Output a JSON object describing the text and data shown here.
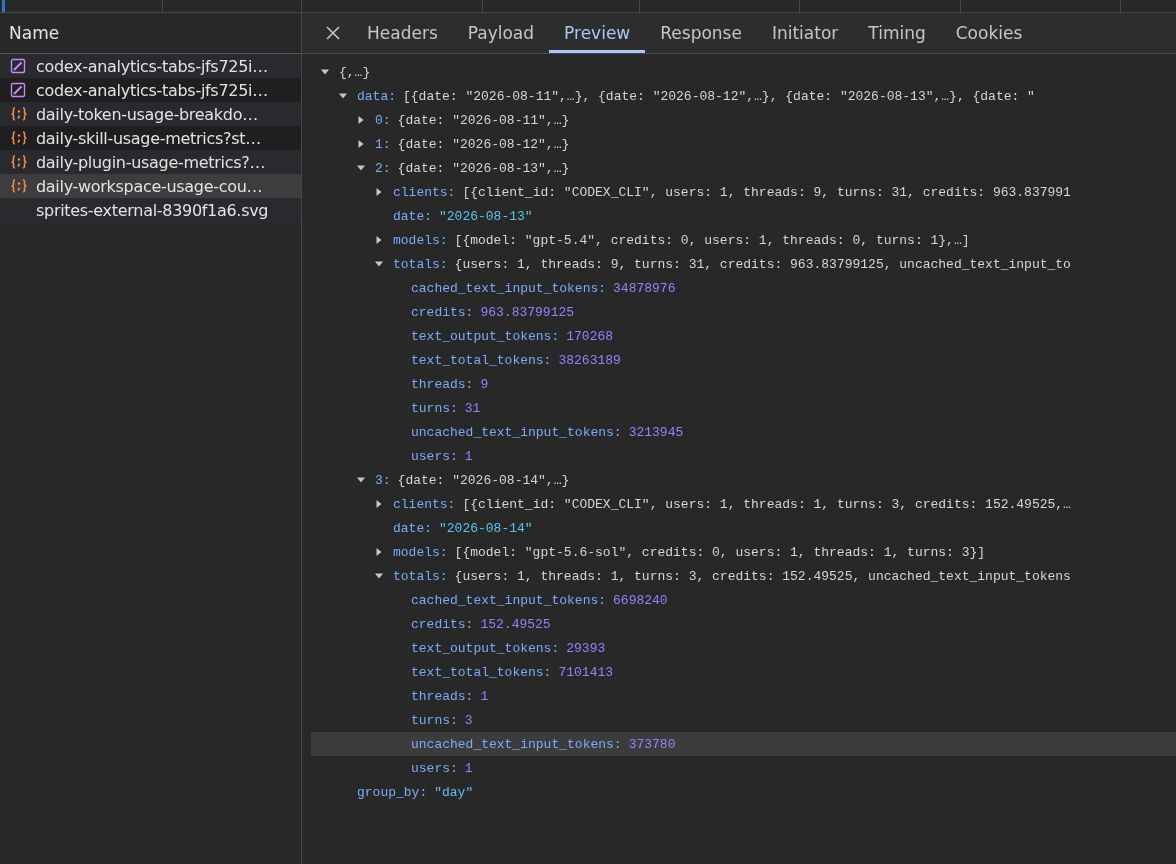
{
  "requests": {
    "header": "Name",
    "items": [
      {
        "name": "codex-analytics-tabs-jfs725i…",
        "kind": "image",
        "selected": false
      },
      {
        "name": "codex-analytics-tabs-jfs725i…",
        "kind": "image",
        "selected": false
      },
      {
        "name": "daily-token-usage-breakdo…",
        "kind": "json",
        "selected": false
      },
      {
        "name": "daily-skill-usage-metrics?st…",
        "kind": "json",
        "selected": false
      },
      {
        "name": "daily-plugin-usage-metrics?…",
        "kind": "json",
        "selected": false
      },
      {
        "name": "daily-workspace-usage-cou…",
        "kind": "json",
        "selected": true
      },
      {
        "name": "sprites-external-8390f1a6.svg",
        "kind": "none",
        "selected": false
      }
    ]
  },
  "detail_tabs": [
    {
      "label": "Headers",
      "selected": false
    },
    {
      "label": "Payload",
      "selected": false
    },
    {
      "label": "Preview",
      "selected": true
    },
    {
      "label": "Response",
      "selected": false
    },
    {
      "label": "Initiator",
      "selected": false
    },
    {
      "label": "Timing",
      "selected": false
    },
    {
      "label": "Cookies",
      "selected": false
    }
  ],
  "preview": {
    "root": {
      "kind": "object",
      "summary": "{,…}",
      "expanded": true,
      "selected": false,
      "children": [
        {
          "key": "data:",
          "kind": "object",
          "summary": "[{date: \"2026-08-11\",…}, {date: \"2026-08-12\",…}, {date: \"2026-08-13\",…}, {date: \"",
          "expanded": true,
          "selected": false,
          "children": [
            {
              "key": "0:",
              "kind": "object",
              "summary": "{date: \"2026-08-11\",…}",
              "expanded": false,
              "selected": false
            },
            {
              "key": "1:",
              "kind": "object",
              "summary": "{date: \"2026-08-12\",…}",
              "expanded": false,
              "selected": false
            },
            {
              "key": "2:",
              "kind": "object",
              "summary": "{date: \"2026-08-13\",…}",
              "expanded": true,
              "selected": false,
              "children": [
                {
                  "key": "clients:",
                  "kind": "object",
                  "summary": "[{client_id: \"CODEX_CLI\", users: 1, threads: 9, turns: 31, credits: 963.837991",
                  "expanded": false,
                  "selected": false
                },
                {
                  "key": "date:",
                  "kind": "string",
                  "value": "\"2026-08-13\"",
                  "selected": false
                },
                {
                  "key": "models:",
                  "kind": "object",
                  "summary": "[{model: \"gpt-5.4\", credits: 0, users: 1, threads: 0, turns: 1},…]",
                  "expanded": false,
                  "selected": false
                },
                {
                  "key": "totals:",
                  "kind": "object",
                  "summary": "{users: 1, threads: 9, turns: 31, credits: 963.83799125, uncached_text_input_to",
                  "expanded": true,
                  "selected": false,
                  "children": [
                    {
                      "key": "cached_text_input_tokens:",
                      "kind": "number",
                      "value": "34878976",
                      "selected": false
                    },
                    {
                      "key": "credits:",
                      "kind": "number",
                      "value": "963.83799125",
                      "selected": false
                    },
                    {
                      "key": "text_output_tokens:",
                      "kind": "number",
                      "value": "170268",
                      "selected": false
                    },
                    {
                      "key": "text_total_tokens:",
                      "kind": "number",
                      "value": "38263189",
                      "selected": false
                    },
                    {
                      "key": "threads:",
                      "kind": "number",
                      "value": "9",
                      "selected": false
                    },
                    {
                      "key": "turns:",
                      "kind": "number",
                      "value": "31",
                      "selected": false
                    },
                    {
                      "key": "uncached_text_input_tokens:",
                      "kind": "number",
                      "value": "3213945",
                      "selected": false
                    },
                    {
                      "key": "users:",
                      "kind": "number",
                      "value": "1",
                      "selected": false
                    }
                  ]
                }
              ]
            },
            {
              "key": "3:",
              "kind": "object",
              "summary": "{date: \"2026-08-14\",…}",
              "expanded": true,
              "selected": false,
              "children": [
                {
                  "key": "clients:",
                  "kind": "object",
                  "summary": "[{client_id: \"CODEX_CLI\", users: 1, threads: 1, turns: 3, credits: 152.49525,…",
                  "expanded": false,
                  "selected": false
                },
                {
                  "key": "date:",
                  "kind": "string",
                  "value": "\"2026-08-14\"",
                  "selected": false
                },
                {
                  "key": "models:",
                  "kind": "object",
                  "summary": "[{model: \"gpt-5.6-sol\", credits: 0, users: 1, threads: 1, turns: 3}]",
                  "expanded": false,
                  "selected": false
                },
                {
                  "key": "totals:",
                  "kind": "object",
                  "summary": "{users: 1, threads: 1, turns: 3, credits: 152.49525, uncached_text_input_tokens",
                  "expanded": true,
                  "selected": false,
                  "children": [
                    {
                      "key": "cached_text_input_tokens:",
                      "kind": "number",
                      "value": "6698240",
                      "selected": false
                    },
                    {
                      "key": "credits:",
                      "kind": "number",
                      "value": "152.49525",
                      "selected": false
                    },
                    {
                      "key": "text_output_tokens:",
                      "kind": "number",
                      "value": "29393",
                      "selected": false
                    },
                    {
                      "key": "text_total_tokens:",
                      "kind": "number",
                      "value": "7101413",
                      "selected": false
                    },
                    {
                      "key": "threads:",
                      "kind": "number",
                      "value": "1",
                      "selected": false
                    },
                    {
                      "key": "turns:",
                      "kind": "number",
                      "value": "3",
                      "selected": false
                    },
                    {
                      "key": "uncached_text_input_tokens:",
                      "kind": "number",
                      "value": "373780",
                      "selected": true
                    },
                    {
                      "key": "users:",
                      "kind": "number",
                      "value": "1",
                      "selected": false
                    }
                  ]
                }
              ]
            }
          ]
        },
        {
          "key": "group_by:",
          "kind": "string",
          "value": "\"day\"",
          "selected": false
        }
      ]
    }
  }
}
